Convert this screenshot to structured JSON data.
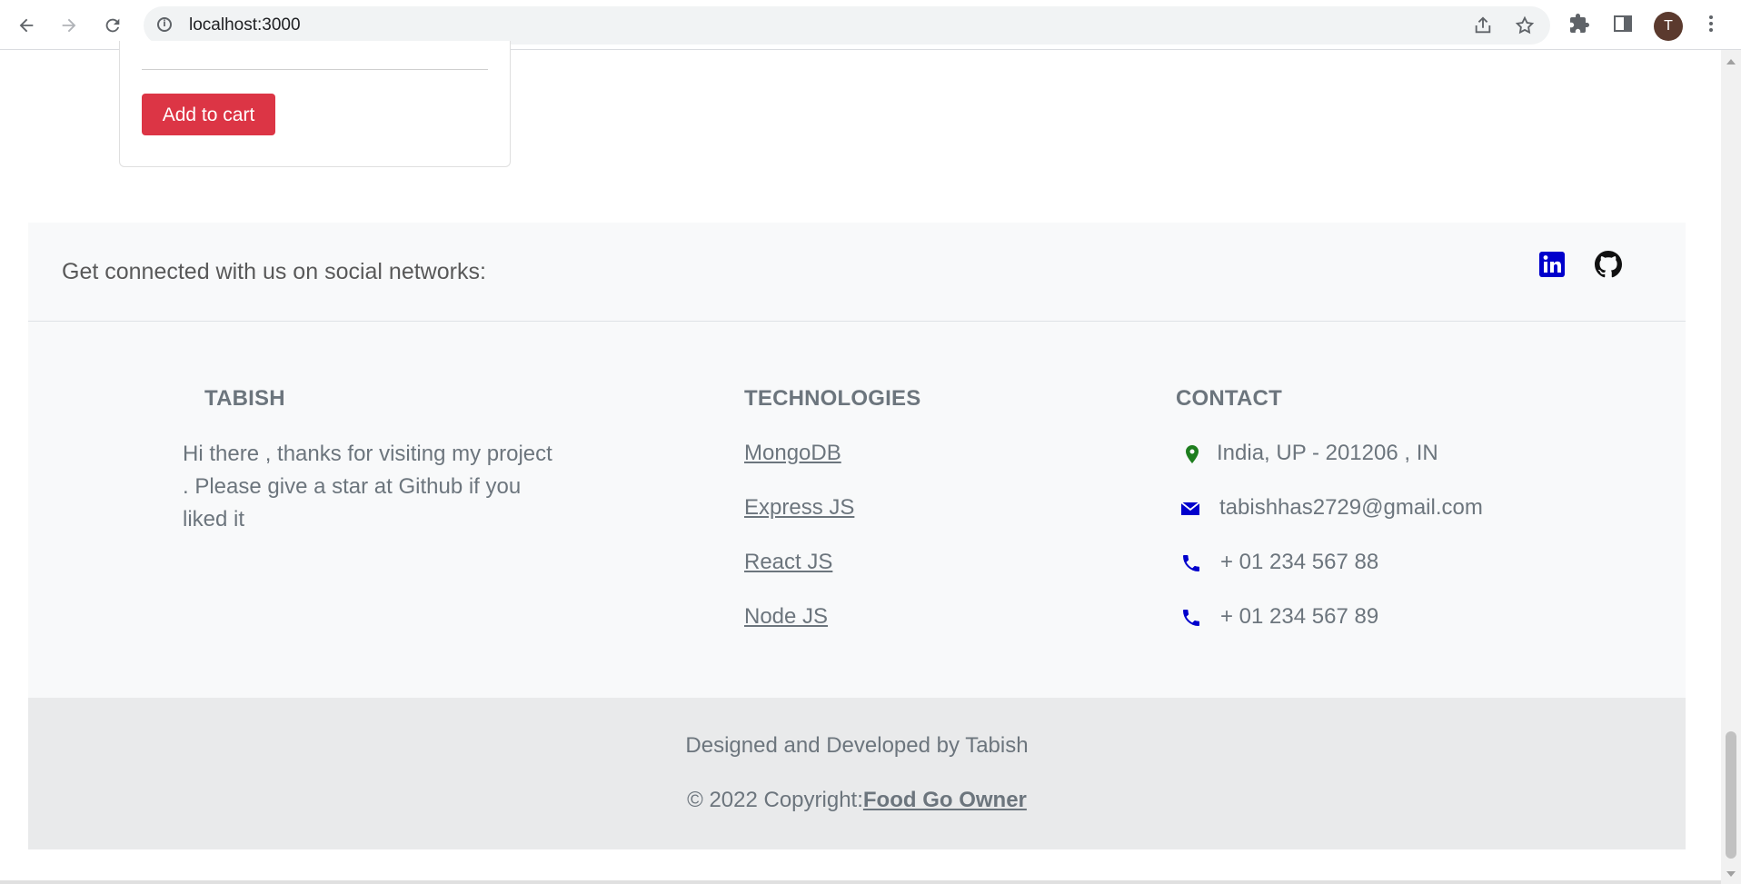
{
  "browser": {
    "url": "localhost:3000",
    "avatar_letter": "T"
  },
  "product_card": {
    "add_to_cart_label": "Add to cart"
  },
  "footer": {
    "social_text": "Get connected with us on social networks:",
    "social_icons": [
      "linkedin-icon",
      "github-icon"
    ],
    "about": {
      "title": "TABISH",
      "text": "Hi there , thanks for visiting my project . Please give a star at Github if you liked it"
    },
    "technologies": {
      "title": "TECHNOLOGIES",
      "links": [
        "MongoDB",
        "Express JS",
        "React JS",
        "Node JS"
      ]
    },
    "contact": {
      "title": "CONTACT",
      "address": "India, UP - 201206 , IN",
      "email": "tabishhas2729@gmail.com",
      "phone_1": "+ 01 234 567 88",
      "phone_2": "+ 01 234 567 89"
    },
    "credit_line": "Designed and Developed by Tabish",
    "copyright_prefix": "© 2022 Copyright:",
    "copyright_link": "Food Go Owner"
  },
  "colors": {
    "accent_red": "#dc3545",
    "linkedin_blue": "#0000cc",
    "location_green": "#1e7e1e",
    "icon_blue": "#0000cc"
  }
}
